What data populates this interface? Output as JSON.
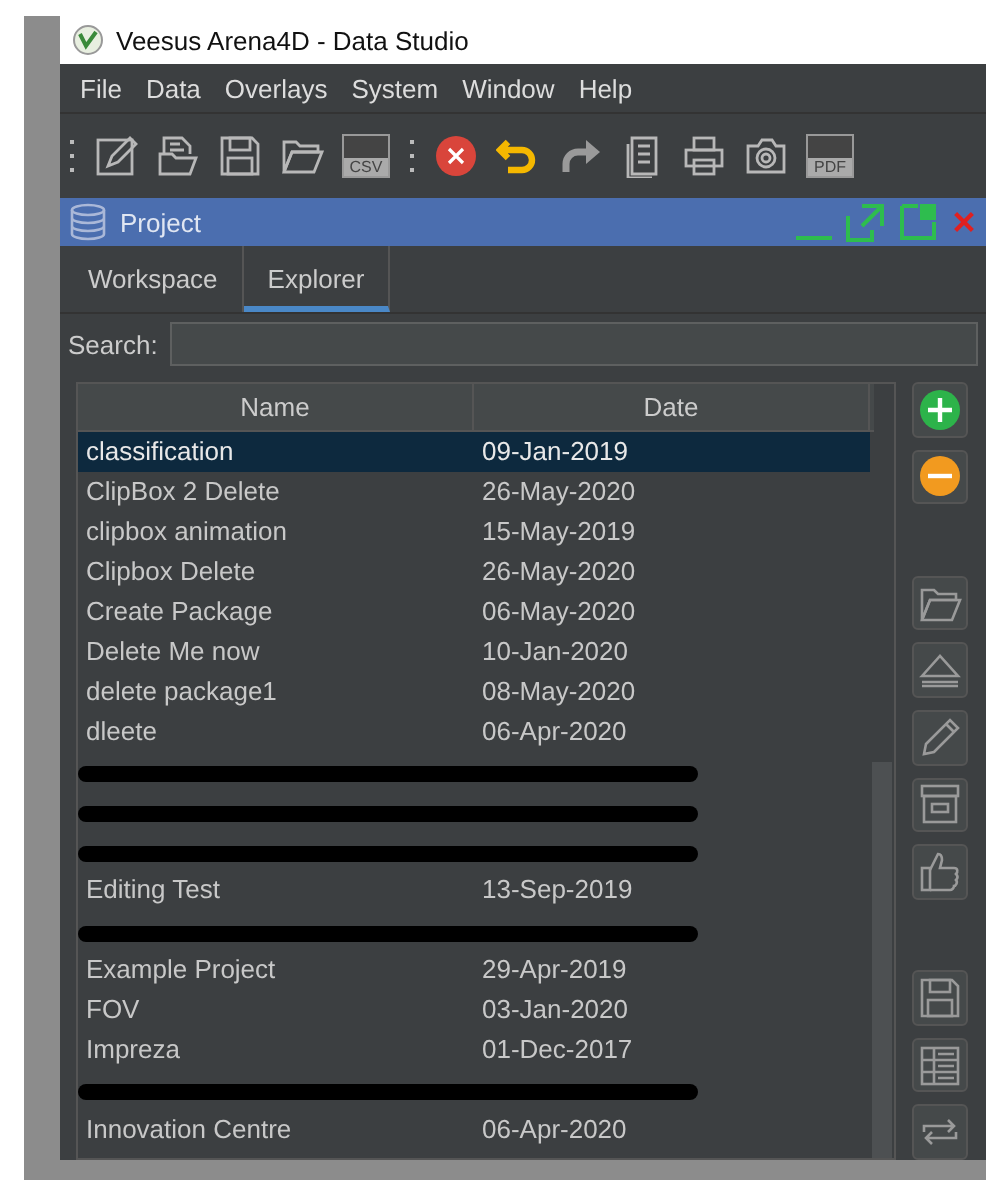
{
  "window": {
    "title": "Veesus Arena4D - Data Studio"
  },
  "menu": [
    "File",
    "Data",
    "Overlays",
    "System",
    "Window",
    "Help"
  ],
  "toolbar": [
    {
      "kind": "grip"
    },
    {
      "kind": "edit"
    },
    {
      "kind": "open-file"
    },
    {
      "kind": "save"
    },
    {
      "kind": "folder"
    },
    {
      "kind": "badge",
      "label": "CSV"
    },
    {
      "kind": "grip"
    },
    {
      "kind": "stop"
    },
    {
      "kind": "undo"
    },
    {
      "kind": "redo"
    },
    {
      "kind": "document"
    },
    {
      "kind": "printer"
    },
    {
      "kind": "camera"
    },
    {
      "kind": "badge",
      "label": "PDF"
    }
  ],
  "panel": {
    "title": "Project"
  },
  "tabs": [
    {
      "label": "Workspace",
      "selected": false
    },
    {
      "label": "Explorer",
      "selected": true
    }
  ],
  "search": {
    "label": "Search:"
  },
  "table": {
    "columns": [
      "Name",
      "Date"
    ],
    "rows": [
      {
        "kind": "entry",
        "name": "classification",
        "date": "09-Jan-2019",
        "selected": true
      },
      {
        "kind": "entry",
        "name": "ClipBox 2 Delete",
        "date": "26-May-2020",
        "selected": false
      },
      {
        "kind": "entry",
        "name": "clipbox animation",
        "date": "15-May-2019",
        "selected": false
      },
      {
        "kind": "entry",
        "name": "Clipbox Delete",
        "date": "26-May-2020",
        "selected": false
      },
      {
        "kind": "entry",
        "name": "Create Package",
        "date": "06-May-2020",
        "selected": false
      },
      {
        "kind": "entry",
        "name": "Delete Me now",
        "date": "10-Jan-2020",
        "selected": false
      },
      {
        "kind": "entry",
        "name": "delete package1",
        "date": "08-May-2020",
        "selected": false
      },
      {
        "kind": "entry",
        "name": "dleete",
        "date": "06-Apr-2020",
        "selected": false
      },
      {
        "kind": "redacted",
        "selected": false
      },
      {
        "kind": "redacted",
        "selected": false
      },
      {
        "kind": "redacted",
        "selected": false
      },
      {
        "kind": "entry",
        "name": "Editing Test",
        "date": "13-Sep-2019",
        "selected": false
      },
      {
        "kind": "redacted",
        "selected": false
      },
      {
        "kind": "entry",
        "name": "Example Project",
        "date": "29-Apr-2019",
        "selected": false
      },
      {
        "kind": "entry",
        "name": "FOV",
        "date": "03-Jan-2020",
        "selected": false
      },
      {
        "kind": "entry",
        "name": "Impreza",
        "date": "01-Dec-2017",
        "selected": false
      },
      {
        "kind": "redacted",
        "selected": false
      },
      {
        "kind": "entry",
        "name": "Innovation Centre",
        "date": "06-Apr-2020",
        "selected": false
      }
    ]
  },
  "side_buttons": [
    {
      "kind": "add"
    },
    {
      "kind": "remove"
    },
    {
      "kind": "gap"
    },
    {
      "kind": "folder"
    },
    {
      "kind": "eject"
    },
    {
      "kind": "pencil"
    },
    {
      "kind": "archive"
    },
    {
      "kind": "thumbs-up"
    },
    {
      "kind": "gap"
    },
    {
      "kind": "save"
    },
    {
      "kind": "list"
    },
    {
      "kind": "repeat"
    }
  ]
}
